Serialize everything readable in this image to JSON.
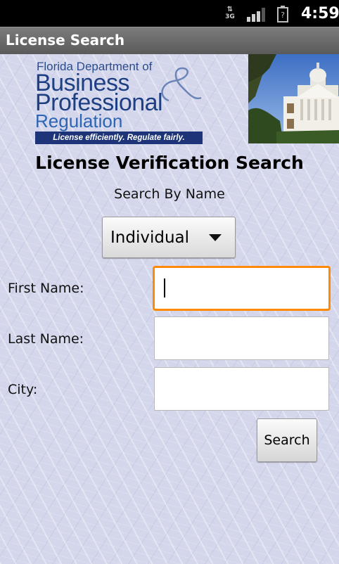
{
  "status_bar": {
    "network": "3G",
    "time": "4:59"
  },
  "title_bar": {
    "title": "License Search"
  },
  "logo": {
    "line1": "Florida Department of",
    "line2": "Business",
    "line3": "Professional",
    "line4": "Regulation",
    "tagline": "License efficiently.  Regulate fairly."
  },
  "form": {
    "heading": "License Verification Search",
    "subheading": "Search By Name",
    "type_selected": "Individual",
    "first_name_label": "First Name:",
    "first_name_value": "",
    "last_name_label": "Last Name:",
    "last_name_value": "",
    "city_label": "City:",
    "city_value": "",
    "search_label": "Search"
  },
  "colors": {
    "focus_border": "#ff8a00",
    "background": "#d4d7ec",
    "logo_blue": "#1f3f83"
  }
}
